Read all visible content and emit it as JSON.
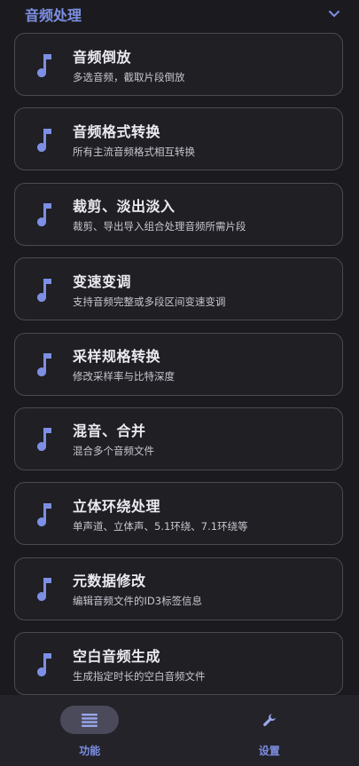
{
  "section": {
    "title": "音频处理",
    "icon": "chevron-down-icon"
  },
  "items": [
    {
      "title": "音频倒放",
      "desc": "多选音频，截取片段倒放",
      "icon": "music-note-icon"
    },
    {
      "title": "音频格式转换",
      "desc": "所有主流音频格式相互转换",
      "icon": "music-note-icon"
    },
    {
      "title": "裁剪、淡出淡入",
      "desc": "裁剪、导出导入组合处理音频所需片段",
      "icon": "music-note-icon"
    },
    {
      "title": "变速变调",
      "desc": "支持音频完整或多段区间变速变调",
      "icon": "music-note-icon"
    },
    {
      "title": "采样规格转换",
      "desc": "修改采样率与比特深度",
      "icon": "music-note-icon"
    },
    {
      "title": "混音、合并",
      "desc": "混合多个音频文件",
      "icon": "music-note-icon"
    },
    {
      "title": "立体环绕处理",
      "desc": "单声道、立体声、5.1环绕、7.1环绕等",
      "icon": "music-note-icon"
    },
    {
      "title": "元数据修改",
      "desc": "编辑音频文件的ID3标签信息",
      "icon": "music-note-icon"
    },
    {
      "title": "空白音频生成",
      "desc": "生成指定时长的空白音频文件",
      "icon": "music-note-icon"
    }
  ],
  "nav": [
    {
      "label": "功能",
      "icon": "list-icon",
      "active": true
    },
    {
      "label": "设置",
      "icon": "wrench-icon",
      "active": false
    }
  ],
  "colors": {
    "accent": "#7d8fe4",
    "background": "#1b1b1f",
    "card_border": "#4a4a52"
  }
}
